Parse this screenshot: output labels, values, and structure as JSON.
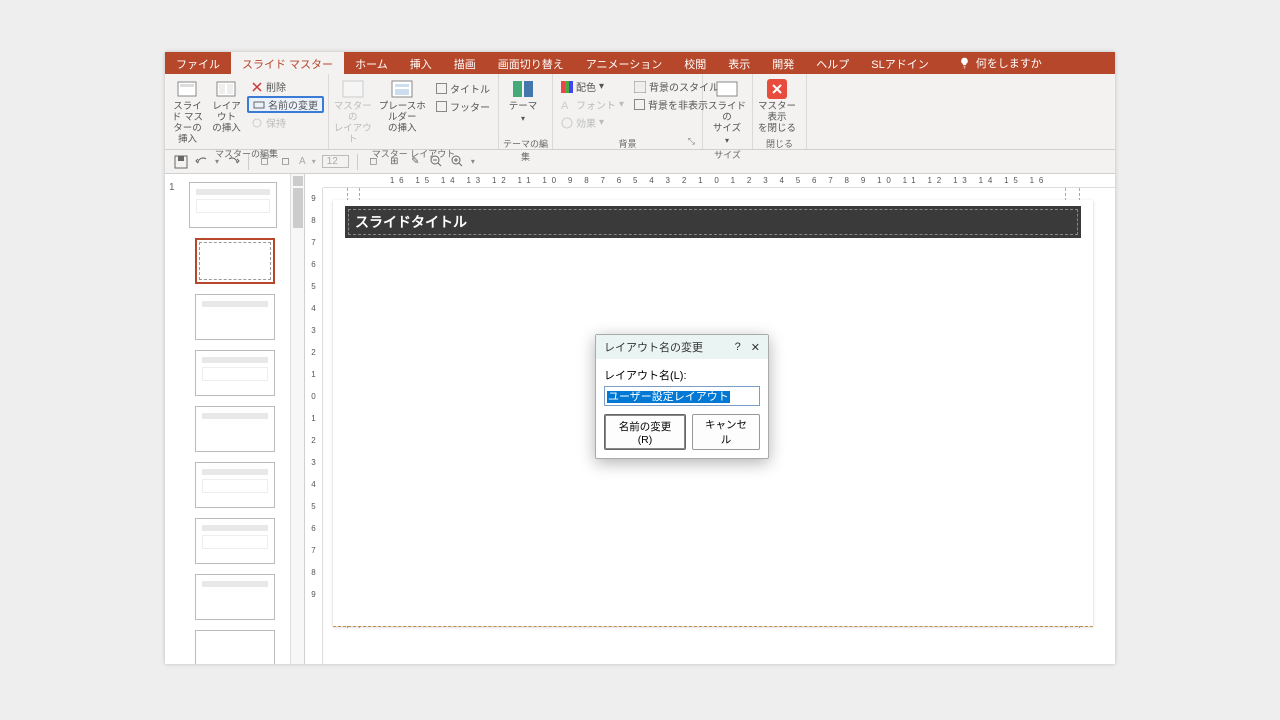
{
  "tabs": [
    "ファイル",
    "スライド マスター",
    "ホーム",
    "挿入",
    "描画",
    "画面切り替え",
    "アニメーション",
    "校閲",
    "表示",
    "開発",
    "ヘルプ",
    "SLアドイン"
  ],
  "tellme": "何をしますか",
  "ribbon": {
    "insert_master": "スライド マス\nターの挿入",
    "insert_layout": "レイアウト\nの挿入",
    "delete": "削除",
    "rename": "名前の変更",
    "preserve": "保持",
    "master_layout": "マスターの\nレイアウト",
    "placeholder": "プレースホルダー\nの挿入",
    "title_chk": "タイトル",
    "footer_chk": "フッター",
    "themes": "テーマ",
    "colors": "配色",
    "fonts": "フォント",
    "effects": "効果",
    "bg_styles": "背景のスタイル",
    "hide_bg": "背景を非表示",
    "slide_size": "スライドの\nサイズ",
    "close_master": "マスター表示\nを閉じる",
    "g_edit": "マスターの編集",
    "g_layout": "マスター レイアウト",
    "g_theme": "テーマの編集",
    "g_bg": "背景",
    "g_size": "サイズ",
    "g_close": "閉じる"
  },
  "ruler_h": "16 15 14 13 12 11 10 9 8 7 6 5 4 3 2 1 0 1 2 3 4 5 6 7 8 9 10 11 12 13 14 15 16",
  "ruler_v": [
    "9",
    "8",
    "7",
    "6",
    "5",
    "4",
    "3",
    "2",
    "1",
    "0",
    "1",
    "2",
    "3",
    "4",
    "5",
    "6",
    "7",
    "8",
    "9"
  ],
  "thumb_num": "1",
  "slide_title": "スライドタイトル",
  "qat": {
    "fontsize": "12"
  },
  "dialog": {
    "title": "レイアウト名の変更",
    "label": "レイアウト名(L):",
    "value": "ユーザー設定レイアウト",
    "rename_btn": "名前の変更(R)",
    "cancel_btn": "キャンセル",
    "help": "?",
    "close": "✕"
  }
}
